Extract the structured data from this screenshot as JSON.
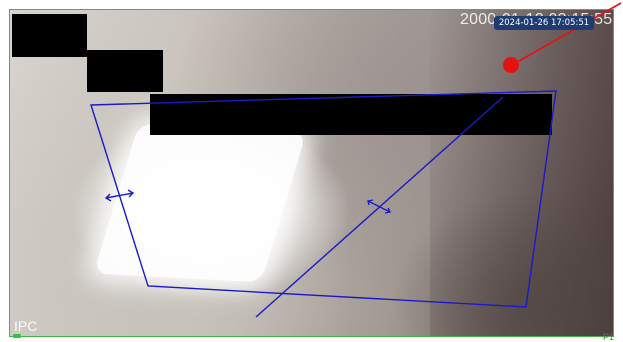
{
  "video": {
    "osd_timestamp": "2000-01-12 03:15:55",
    "camera_label": "IPC",
    "channel_label": "P1"
  },
  "annotation": {
    "timestamp_badge": "2024-01-26 17:05:51",
    "pointer_color": "#e51212"
  },
  "colors": {
    "detection_lines": "#1a1ac8",
    "frame_border": "#49b04a",
    "badge": "#1e3b73",
    "privacy_mask": "#000000"
  },
  "icons": {
    "pointer": "red-dot-marker",
    "status": "green-led"
  }
}
